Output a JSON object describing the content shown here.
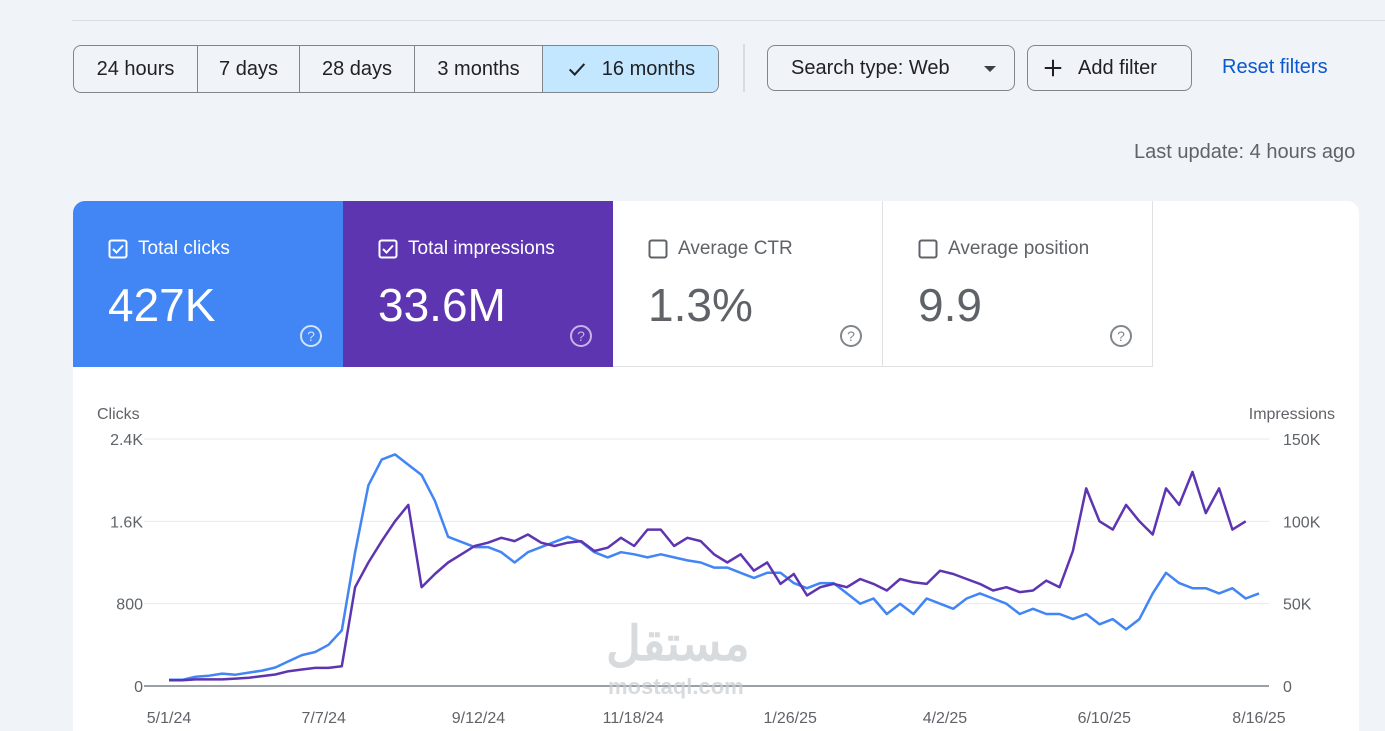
{
  "date_range": {
    "options": [
      "24 hours",
      "7 days",
      "28 days",
      "3 months",
      "16 months"
    ],
    "selected": "16 months"
  },
  "filters": {
    "search_type": "Search type: Web",
    "add_filter": "Add filter",
    "reset": "Reset filters"
  },
  "last_update": "Last update: 4 hours ago",
  "metrics": [
    {
      "label": "Total clicks",
      "value": "427K",
      "checked": true,
      "color": "#4285f4"
    },
    {
      "label": "Total impressions",
      "value": "33.6M",
      "checked": true,
      "color": "#5e35b1"
    },
    {
      "label": "Average CTR",
      "value": "1.3%",
      "checked": false
    },
    {
      "label": "Average position",
      "value": "9.9",
      "checked": false
    }
  ],
  "watermark": {
    "arabic": "مستقل",
    "latin": "mostaql.com"
  },
  "chart_data": {
    "type": "line",
    "y_left_label": "Clicks",
    "y_right_label": "Impressions",
    "y_left_ticks": [
      "0",
      "800",
      "1.6K",
      "2.4K"
    ],
    "y_right_ticks": [
      "0",
      "50K",
      "100K",
      "150K"
    ],
    "ylim_left": [
      0,
      2400
    ],
    "ylim_right": [
      0,
      150000
    ],
    "x_ticks": [
      "5/1/24",
      "7/7/24",
      "9/12/24",
      "11/18/24",
      "1/26/25",
      "4/2/25",
      "6/10/25",
      "8/16/25"
    ],
    "x_tick_index": [
      0,
      67,
      134,
      201,
      269,
      336,
      405,
      472
    ],
    "grid": true,
    "series": [
      {
        "name": "Clicks",
        "axis": "left",
        "color": "#4285f4",
        "values": [
          60,
          60,
          90,
          100,
          120,
          110,
          130,
          150,
          180,
          240,
          300,
          330,
          400,
          540,
          1300,
          1950,
          2200,
          2250,
          2150,
          2050,
          1800,
          1450,
          1400,
          1350,
          1350,
          1300,
          1200,
          1300,
          1350,
          1400,
          1450,
          1400,
          1300,
          1250,
          1300,
          1280,
          1250,
          1280,
          1250,
          1220,
          1200,
          1150,
          1150,
          1100,
          1050,
          1100,
          1100,
          1000,
          950,
          1000,
          1000,
          900,
          800,
          850,
          700,
          800,
          700,
          850,
          800,
          750,
          850,
          900,
          850,
          800,
          700,
          750,
          700,
          700,
          650,
          700,
          600,
          650,
          550,
          650,
          900,
          1100,
          1000,
          950,
          950,
          900,
          950,
          850,
          900
        ]
      },
      {
        "name": "Impressions",
        "axis": "right",
        "color": "#5e35b1",
        "values": [
          3500,
          3500,
          4000,
          4000,
          4000,
          4500,
          5000,
          6000,
          7000,
          9000,
          10000,
          11000,
          11000,
          12000,
          60000,
          75000,
          88000,
          100000,
          110000,
          60000,
          68000,
          75000,
          80000,
          85000,
          87000,
          90000,
          88000,
          92000,
          87000,
          85000,
          87000,
          88000,
          82000,
          84000,
          90000,
          85000,
          95000,
          95000,
          85000,
          90000,
          88000,
          80000,
          75000,
          80000,
          70000,
          75000,
          62000,
          68000,
          55000,
          60000,
          62000,
          60000,
          65000,
          62000,
          58000,
          65000,
          63000,
          62000,
          70000,
          68000,
          65000,
          62000,
          58000,
          60000,
          57000,
          58000,
          64000,
          60000,
          82000,
          120000,
          100000,
          95000,
          110000,
          100000,
          92000,
          120000,
          110000,
          130000,
          105000,
          120000,
          95000,
          100000
        ]
      }
    ]
  }
}
